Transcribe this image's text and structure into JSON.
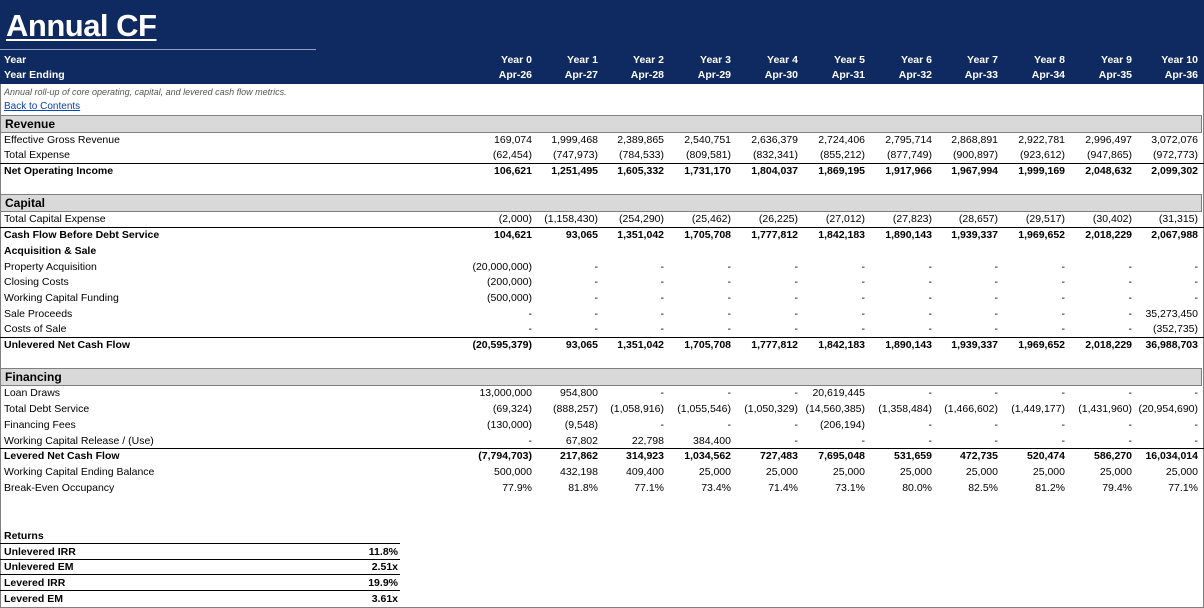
{
  "title": "Annual CF",
  "description": "Annual roll-up of core operating, capital, and levered cash flow metrics.",
  "back_link": "Back to Contents",
  "header": {
    "year_label": "Year",
    "ending_label": "Year Ending",
    "years": [
      "Year 0",
      "Year 1",
      "Year 2",
      "Year 3",
      "Year 4",
      "Year 5",
      "Year 6",
      "Year 7",
      "Year 8",
      "Year 9",
      "Year 10"
    ],
    "ending": [
      "Apr-26",
      "Apr-27",
      "Apr-28",
      "Apr-29",
      "Apr-30",
      "Apr-31",
      "Apr-32",
      "Apr-33",
      "Apr-34",
      "Apr-35",
      "Apr-36"
    ]
  },
  "sections": {
    "revenue": "Revenue",
    "capital": "Capital",
    "financing": "Financing"
  },
  "rows": {
    "egr": {
      "label": "Effective Gross Revenue",
      "values": [
        "169,074",
        "1,999,468",
        "2,389,865",
        "2,540,751",
        "2,636,379",
        "2,724,406",
        "2,795,714",
        "2,868,891",
        "2,922,781",
        "2,996,497",
        "3,072,076"
      ]
    },
    "texp": {
      "label": "Total Expense",
      "values": [
        "(62,454)",
        "(747,973)",
        "(784,533)",
        "(809,581)",
        "(832,341)",
        "(855,212)",
        "(877,749)",
        "(900,897)",
        "(923,612)",
        "(947,865)",
        "(972,773)"
      ]
    },
    "noi": {
      "label": "Net Operating Income",
      "values": [
        "106,621",
        "1,251,495",
        "1,605,332",
        "1,731,170",
        "1,804,037",
        "1,869,195",
        "1,917,966",
        "1,967,994",
        "1,999,169",
        "2,048,632",
        "2,099,302"
      ]
    },
    "tcap": {
      "label": "Total Capital Expense",
      "values": [
        "(2,000)",
        "(1,158,430)",
        "(254,290)",
        "(25,462)",
        "(26,225)",
        "(27,012)",
        "(27,823)",
        "(28,657)",
        "(29,517)",
        "(30,402)",
        "(31,315)"
      ]
    },
    "cfbds": {
      "label": "Cash Flow Before Debt Service",
      "values": [
        "104,621",
        "93,065",
        "1,351,042",
        "1,705,708",
        "1,777,812",
        "1,842,183",
        "1,890,143",
        "1,939,337",
        "1,969,652",
        "2,018,229",
        "2,067,988"
      ]
    },
    "acq_header": {
      "label": "Acquisition & Sale"
    },
    "prop_acq": {
      "label": "Property Acquisition",
      "values": [
        "(20,000,000)",
        "-",
        "-",
        "-",
        "-",
        "-",
        "-",
        "-",
        "-",
        "-",
        "-"
      ]
    },
    "closing": {
      "label": "Closing Costs",
      "values": [
        "(200,000)",
        "-",
        "-",
        "-",
        "-",
        "-",
        "-",
        "-",
        "-",
        "-",
        "-"
      ]
    },
    "wcf": {
      "label": "Working Capital Funding",
      "values": [
        "(500,000)",
        "-",
        "-",
        "-",
        "-",
        "-",
        "-",
        "-",
        "-",
        "-",
        "-"
      ]
    },
    "sale": {
      "label": "Sale Proceeds",
      "values": [
        "-",
        "-",
        "-",
        "-",
        "-",
        "-",
        "-",
        "-",
        "-",
        "-",
        "35,273,450"
      ]
    },
    "cos": {
      "label": "Costs of Sale",
      "values": [
        "-",
        "-",
        "-",
        "-",
        "-",
        "-",
        "-",
        "-",
        "-",
        "-",
        "(352,735)"
      ]
    },
    "uncf": {
      "label": "Unlevered Net Cash Flow",
      "values": [
        "(20,595,379)",
        "93,065",
        "1,351,042",
        "1,705,708",
        "1,777,812",
        "1,842,183",
        "1,890,143",
        "1,939,337",
        "1,969,652",
        "2,018,229",
        "36,988,703"
      ]
    },
    "loan": {
      "label": "Loan Draws",
      "values": [
        "13,000,000",
        "954,800",
        "-",
        "-",
        "-",
        "20,619,445",
        "-",
        "-",
        "-",
        "-",
        "-"
      ]
    },
    "tds": {
      "label": "Total Debt Service",
      "values": [
        "(69,324)",
        "(888,257)",
        "(1,058,916)",
        "(1,055,546)",
        "(1,050,329)",
        "(14,560,385)",
        "(1,358,484)",
        "(1,466,602)",
        "(1,449,177)",
        "(1,431,960)",
        "(20,954,690)"
      ]
    },
    "ffees": {
      "label": "Financing Fees",
      "values": [
        "(130,000)",
        "(9,548)",
        "-",
        "-",
        "-",
        "(206,194)",
        "-",
        "-",
        "-",
        "-",
        "-"
      ]
    },
    "wcr": {
      "label": "Working Capital Release / (Use)",
      "values": [
        "-",
        "67,802",
        "22,798",
        "384,400",
        "-",
        "-",
        "-",
        "-",
        "-",
        "-",
        "-"
      ]
    },
    "lncf": {
      "label": "Levered Net Cash Flow",
      "values": [
        "(7,794,703)",
        "217,862",
        "314,923",
        "1,034,562",
        "727,483",
        "7,695,048",
        "531,659",
        "472,735",
        "520,474",
        "586,270",
        "16,034,014"
      ]
    },
    "wceb": {
      "label": "Working Capital Ending Balance",
      "values": [
        "500,000",
        "432,198",
        "409,400",
        "25,000",
        "25,000",
        "25,000",
        "25,000",
        "25,000",
        "25,000",
        "25,000",
        "25,000"
      ]
    },
    "beo": {
      "label": "Break-Even Occupancy",
      "values": [
        "77.9%",
        "81.8%",
        "77.1%",
        "73.4%",
        "71.4%",
        "73.1%",
        "80.0%",
        "82.5%",
        "81.2%",
        "79.4%",
        "77.1%"
      ]
    }
  },
  "returns": {
    "label": "Returns",
    "items": [
      {
        "label": "Unlevered IRR",
        "value": "11.8%"
      },
      {
        "label": "Unlevered EM",
        "value": "2.51x"
      },
      {
        "label": "Levered IRR",
        "value": "19.9%"
      },
      {
        "label": "Levered EM",
        "value": "3.61x"
      }
    ]
  },
  "colors": {
    "header_bg": "#0e2a60",
    "section_bg": "#d9d9d9",
    "link": "#0645ad"
  }
}
